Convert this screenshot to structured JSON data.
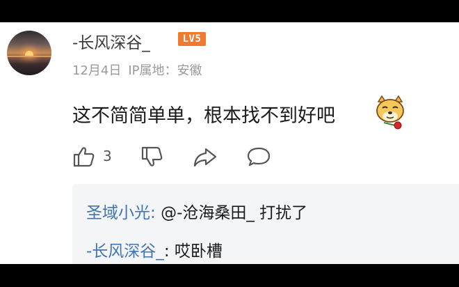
{
  "comment": {
    "username": "-长风深谷_",
    "level_badge": "LV5",
    "date": "12月4日",
    "ip_location": "IP属地：安徽",
    "text": "这不简简单单，根本找不到好吧",
    "emoji": "doge-with-rose",
    "like_count": "3"
  },
  "replies": [
    {
      "author": "圣域小光",
      "separator": ": ",
      "text": "@-沧海桑田_ 打扰了"
    },
    {
      "author": "-长风深谷_",
      "separator": ": ",
      "text": "哎卧槽"
    }
  ],
  "colors": {
    "level_badge": "#f07a2f",
    "reply_name": "#3f74b8",
    "reply_bg": "#f4f5f7",
    "meta_text": "#9a9a9a"
  }
}
